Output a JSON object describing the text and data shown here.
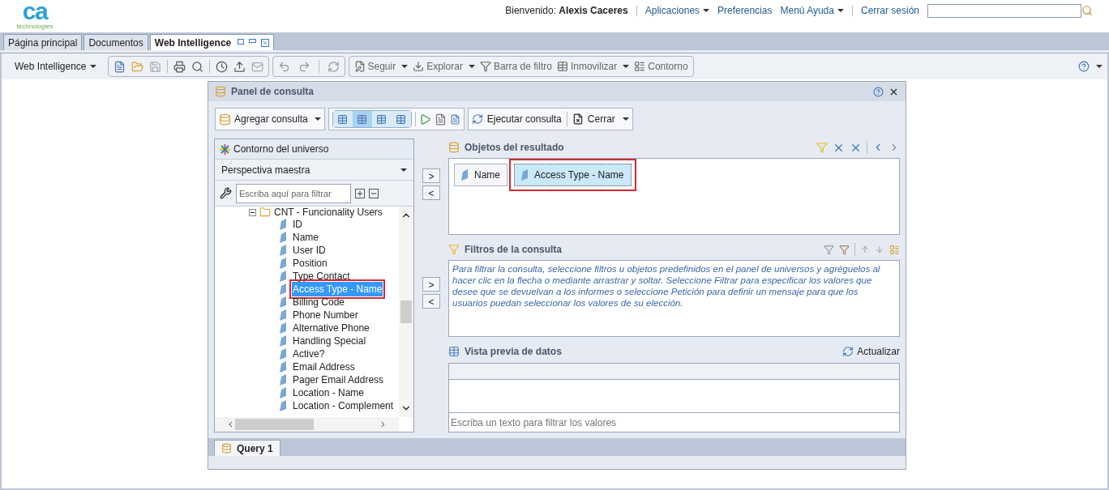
{
  "header": {
    "logo": {
      "mark": "ca",
      "tagline": "technologies"
    },
    "welcome": "Bienvenido:",
    "user": "Alexis Caceres",
    "links": [
      {
        "label": "Aplicaciones",
        "menu": true
      },
      {
        "label": "Preferencias",
        "menu": false
      },
      {
        "label": "Menú Ayuda",
        "menu": true
      },
      {
        "label": "Cerrar sesión",
        "menu": false
      }
    ]
  },
  "tabs": [
    {
      "label": "Página principal",
      "selected": false
    },
    {
      "label": "Documentos",
      "selected": false
    },
    {
      "label": "Web Intelligence",
      "selected": true
    }
  ],
  "toolbar": {
    "app_menu": "Web Intelligence",
    "buttons": [
      {
        "label": "Seguir",
        "menu": true
      },
      {
        "label": "Explorar",
        "menu": true
      },
      {
        "label": "Barra de filtro",
        "menu": false
      },
      {
        "label": "Inmovilizar",
        "menu": true
      },
      {
        "label": "Contorno",
        "menu": false
      }
    ]
  },
  "dialog": {
    "title": "Panel de consulta",
    "toolbar": {
      "add_query": "Agregar consulta",
      "views": [
        {
          "selected": false
        },
        {
          "selected": true
        },
        {
          "selected": false
        },
        {
          "selected": false
        }
      ],
      "run": "Ejecutar consulta",
      "close": "Cerrar"
    },
    "universe": {
      "title": "Contorno del universo",
      "perspective": "Perspectiva maestra",
      "filter_placeholder": "Escriba aquí para filtrar",
      "tree": [
        {
          "label": "CNT - Funcionality Users",
          "expanded": true,
          "children": [
            {
              "label": "ID",
              "selected": false
            },
            {
              "label": "Name",
              "selected": false
            },
            {
              "label": "User ID",
              "selected": false
            },
            {
              "label": "Position",
              "selected": false
            },
            {
              "label": "Type Contact",
              "selected": false
            },
            {
              "label": "Access Type - Name",
              "selected": true
            },
            {
              "label": "Billing Code",
              "selected": false
            },
            {
              "label": "Phone Number",
              "selected": false
            },
            {
              "label": "Alternative Phone",
              "selected": false
            },
            {
              "label": "Handling Special",
              "selected": false
            },
            {
              "label": "Active?",
              "selected": false
            },
            {
              "label": "Email Address",
              "selected": false
            },
            {
              "label": "Pager Email Address",
              "selected": false
            },
            {
              "label": "Location - Name",
              "selected": false
            },
            {
              "label": "Location - Complement",
              "selected": false
            }
          ]
        }
      ]
    },
    "add_arrow": ">",
    "remove_arrow": "<",
    "result_objects": {
      "title": "Objetos del resultado",
      "items": [
        {
          "label": "Name",
          "selected": false
        },
        {
          "label": "Access Type - Name",
          "selected": true
        }
      ]
    },
    "query_filters": {
      "title": "Filtros de la consulta",
      "hint": "Para filtrar la consulta, seleccione filtros u objetos predefinidos en el panel de universos y agréguelos al hacer clic en la flecha o mediante arrastrar y soltar. Seleccione Filtrar para especificar los valores que desee que se devuelvan a los informes o seleccione Petición para definir un mensaje para que los usuarios puedan seleccionar los valores de su elección."
    },
    "data_preview": {
      "title": "Vista previa de datos",
      "refresh": "Actualizar",
      "filter_placeholder": "Escriba un texto para filtrar los valores"
    },
    "query_tabs": [
      {
        "label": "Query 1",
        "selected": true
      }
    ]
  }
}
